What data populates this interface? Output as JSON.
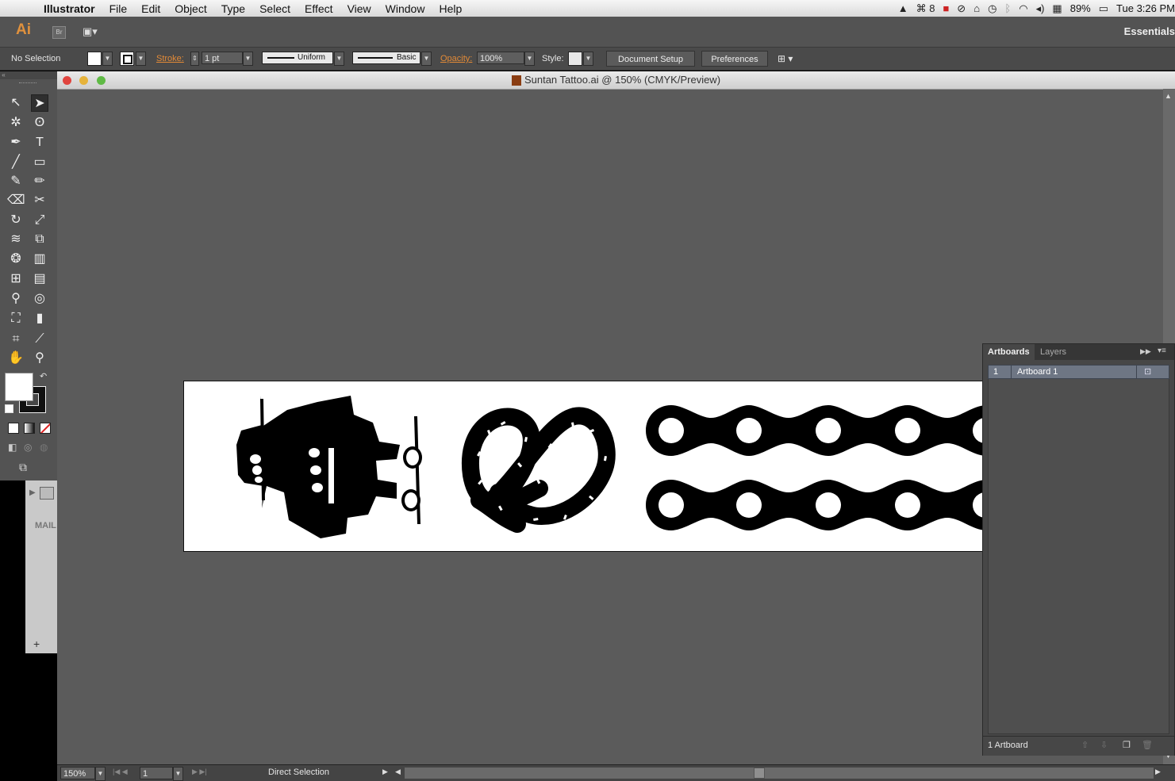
{
  "menubar": {
    "app": "Illustrator",
    "items": [
      "File",
      "Edit",
      "Object",
      "Type",
      "Select",
      "Effect",
      "View",
      "Window",
      "Help"
    ],
    "tray_badge": "8",
    "battery": "89%",
    "clock": "Tue 3:26 PM"
  },
  "appbar": {
    "logo": "Ai",
    "bridge": "Br",
    "workspace": "Essentials"
  },
  "control": {
    "selection": "No Selection",
    "stroke_label": "Stroke:",
    "stroke_weight": "1 pt",
    "profile": "Uniform",
    "brush": "Basic",
    "opacity_label": "Opacity:",
    "opacity_value": "100%",
    "style_label": "Style:",
    "document_setup": "Document Setup",
    "preferences": "Preferences"
  },
  "document": {
    "title": "Suntan Tattoo.ai @ 150% (CMYK/Preview)"
  },
  "status": {
    "zoom": "150%",
    "artboard_num": "1",
    "tool": "Direct Selection"
  },
  "artboards_panel": {
    "tabs": [
      "Artboards",
      "Layers"
    ],
    "rows": [
      {
        "num": "1",
        "name": "Artboard 1"
      }
    ],
    "footer": "1 Artboard"
  },
  "mail_panel": {
    "label": "MAIL"
  }
}
